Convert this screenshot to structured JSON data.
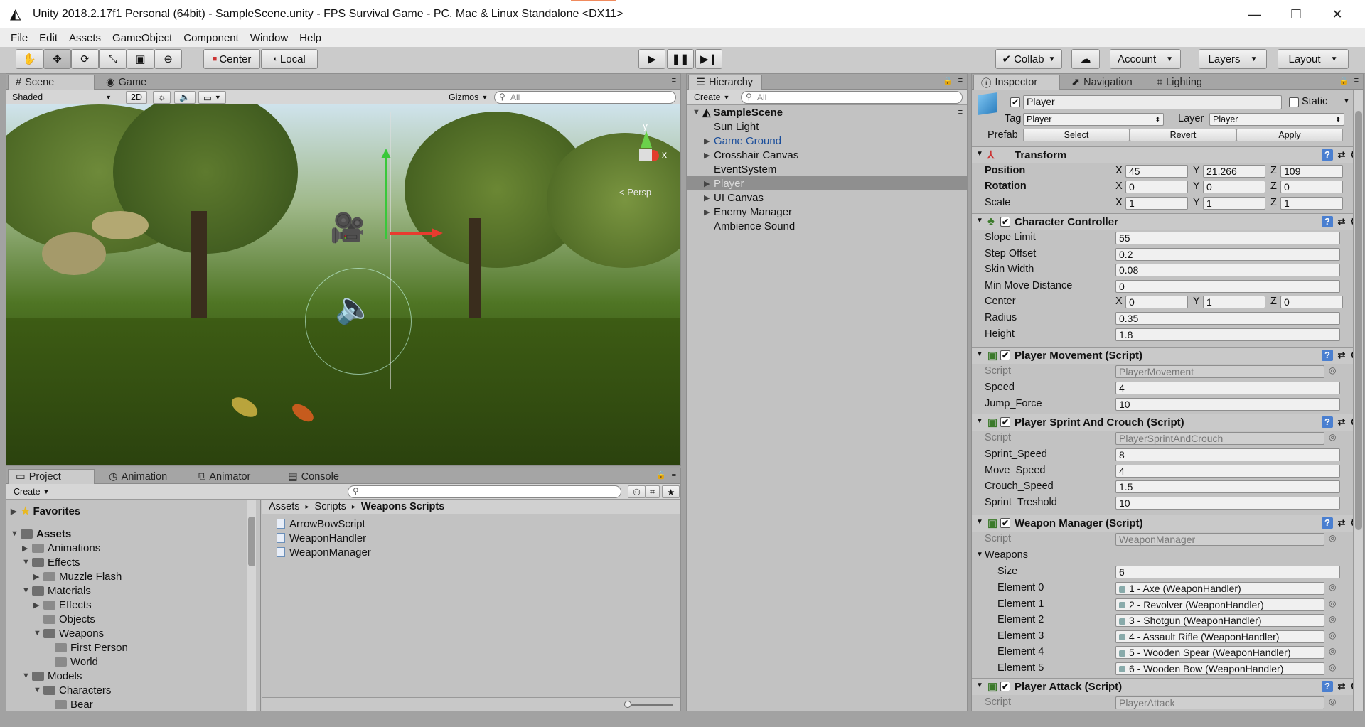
{
  "window": {
    "title": "Unity 2018.2.17f1 Personal (64bit) - SampleScene.unity - FPS Survival Game - PC, Mac & Linux Standalone <DX11>",
    "minimize": "—",
    "maximize": "☐",
    "close": "✕"
  },
  "menu": [
    "File",
    "Edit",
    "Assets",
    "GameObject",
    "Component",
    "Window",
    "Help"
  ],
  "toolbar": {
    "pivot_label": "Center",
    "space_label": "Local",
    "collab_label": "Collab",
    "account_label": "Account",
    "layers_label": "Layers",
    "layout_label": "Layout"
  },
  "scene": {
    "tabs": [
      "Scene",
      "Game"
    ],
    "shading": "Shaded",
    "mode_2d": "2D",
    "gizmos": "Gizmos",
    "search_placeholder": "All",
    "persp_label": "< Persp",
    "axis_y": "y",
    "axis_x": "x"
  },
  "hierarchy": {
    "tab": "Hierarchy",
    "create": "Create",
    "search_placeholder": "All",
    "scene_name": "SampleScene",
    "items": [
      {
        "label": "Sun Light",
        "expandable": false,
        "color": "#111111"
      },
      {
        "label": "Game Ground",
        "expandable": true,
        "color": "#1b4e9b"
      },
      {
        "label": "Crosshair Canvas",
        "expandable": true,
        "color": "#111111"
      },
      {
        "label": "EventSystem",
        "expandable": false,
        "color": "#111111"
      },
      {
        "label": "Player",
        "expandable": true,
        "color": "#dcdcdc",
        "selected": true
      },
      {
        "label": "UI Canvas",
        "expandable": true,
        "color": "#111111"
      },
      {
        "label": "Enemy Manager",
        "expandable": true,
        "color": "#111111"
      },
      {
        "label": "Ambience Sound",
        "expandable": false,
        "color": "#111111"
      }
    ]
  },
  "project": {
    "tabs": [
      "Project",
      "Animation",
      "Animator",
      "Console"
    ],
    "create": "Create",
    "favorites": "Favorites",
    "tree": [
      {
        "label": "Assets",
        "depth": 0,
        "expanded": true,
        "bold": true
      },
      {
        "label": "Animations",
        "depth": 1,
        "expanded": false
      },
      {
        "label": "Effects",
        "depth": 1,
        "expanded": true
      },
      {
        "label": "Muzzle Flash",
        "depth": 2,
        "expanded": false
      },
      {
        "label": "Materials",
        "depth": 1,
        "expanded": true
      },
      {
        "label": "Effects",
        "depth": 2,
        "expanded": false
      },
      {
        "label": "Objects",
        "depth": 2,
        "leaf": true
      },
      {
        "label": "Weapons",
        "depth": 2,
        "expanded": true
      },
      {
        "label": "First Person",
        "depth": 3,
        "leaf": true
      },
      {
        "label": "World",
        "depth": 3,
        "leaf": true
      },
      {
        "label": "Models",
        "depth": 1,
        "expanded": true
      },
      {
        "label": "Characters",
        "depth": 2,
        "expanded": true
      },
      {
        "label": "Bear",
        "depth": 3,
        "leaf": true
      }
    ],
    "breadcrumb": [
      "Assets",
      "Scripts",
      "Weapons Scripts"
    ],
    "files": [
      "ArrowBowScript",
      "WeaponHandler",
      "WeaponManager"
    ]
  },
  "inspector": {
    "tabs": [
      "Inspector",
      "Navigation",
      "Lighting"
    ],
    "object_name": "Player",
    "static_label": "Static",
    "tag_label": "Tag",
    "tag_value": "Player",
    "layer_label": "Layer",
    "layer_value": "Player",
    "prefab_label": "Prefab",
    "prefab_buttons": [
      "Select",
      "Revert",
      "Apply"
    ],
    "transform": {
      "title": "Transform",
      "position": {
        "label": "Position",
        "x": "45",
        "y": "21.266",
        "z": "109"
      },
      "rotation": {
        "label": "Rotation",
        "x": "0",
        "y": "0",
        "z": "0"
      },
      "scale": {
        "label": "Scale",
        "x": "1",
        "y": "1",
        "z": "1"
      }
    },
    "character_controller": {
      "title": "Character Controller",
      "fields": [
        {
          "label": "Slope Limit",
          "value": "55"
        },
        {
          "label": "Step Offset",
          "value": "0.2"
        },
        {
          "label": "Skin Width",
          "value": "0.08"
        },
        {
          "label": "Min Move Distance",
          "value": "0"
        }
      ],
      "center": {
        "label": "Center",
        "x": "0",
        "y": "1",
        "z": "0"
      },
      "fields2": [
        {
          "label": "Radius",
          "value": "0.35"
        },
        {
          "label": "Height",
          "value": "1.8"
        }
      ]
    },
    "player_movement": {
      "title": "Player Movement (Script)",
      "script_label": "Script",
      "script_value": "PlayerMovement",
      "fields": [
        {
          "label": "Speed",
          "value": "4"
        },
        {
          "label": "Jump_Force",
          "value": "10"
        }
      ]
    },
    "player_sprint": {
      "title": "Player Sprint And Crouch (Script)",
      "script_label": "Script",
      "script_value": "PlayerSprintAndCrouch",
      "fields": [
        {
          "label": "Sprint_Speed",
          "value": "8"
        },
        {
          "label": "Move_Speed",
          "value": "4"
        },
        {
          "label": "Crouch_Speed",
          "value": "1.5"
        },
        {
          "label": "Sprint_Treshold",
          "value": "10"
        }
      ]
    },
    "weapon_manager": {
      "title": "Weapon Manager (Script)",
      "script_label": "Script",
      "script_value": "WeaponManager",
      "weapons_label": "Weapons",
      "size_label": "Size",
      "size_value": "6",
      "elements": [
        {
          "label": "Element 0",
          "value": "1 - Axe (WeaponHandler)"
        },
        {
          "label": "Element 1",
          "value": "2 - Revolver (WeaponHandler)"
        },
        {
          "label": "Element 2",
          "value": "3 - Shotgun (WeaponHandler)"
        },
        {
          "label": "Element 3",
          "value": "4 - Assault Rifle (WeaponHandler)"
        },
        {
          "label": "Element 4",
          "value": "5 - Wooden Spear (WeaponHandler)"
        },
        {
          "label": "Element 5",
          "value": "6 - Wooden Bow (WeaponHandler)"
        }
      ]
    },
    "player_attack": {
      "title": "Player Attack (Script)",
      "script_label": "Script",
      "script_value": "PlayerAttack"
    }
  }
}
